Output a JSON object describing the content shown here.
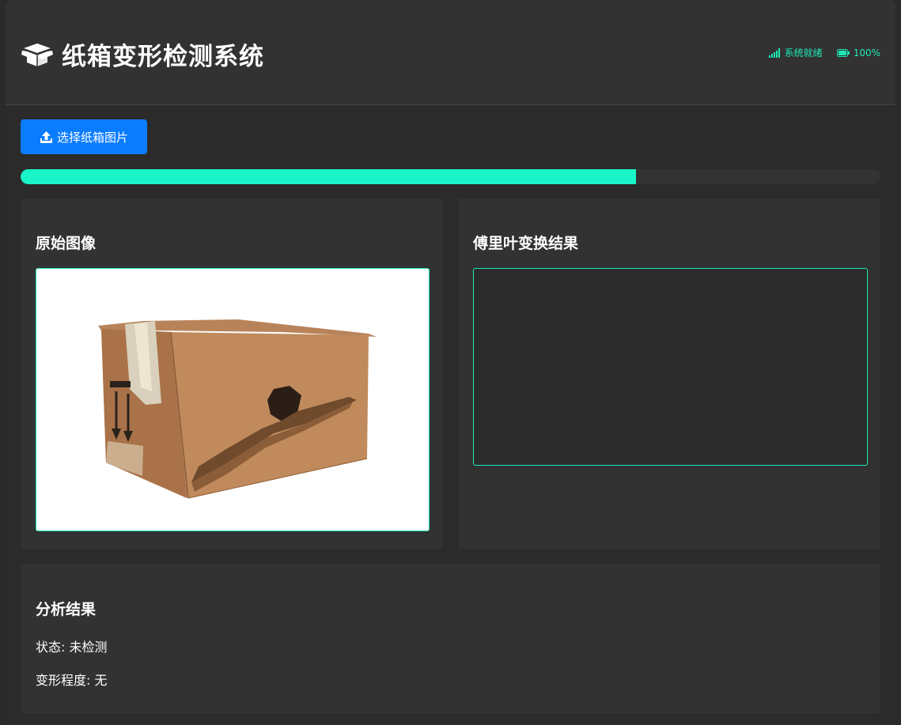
{
  "header": {
    "title": "纸箱变形检测系统",
    "title_icon": "box-open-icon",
    "status": {
      "system_label": "系统就绪",
      "system_icon": "signal-bars-icon",
      "battery_label": "100%",
      "battery_icon": "battery-icon"
    }
  },
  "toolbar": {
    "upload_label": "选择纸箱图片",
    "upload_icon": "upload-icon"
  },
  "progress": {
    "value": 0.716
  },
  "panels": {
    "original": {
      "title": "原始图像",
      "image": "damaged-cardboard-box-photo"
    },
    "fourier": {
      "title": "傅里叶变换结果"
    }
  },
  "analysis": {
    "title": "分析结果",
    "status_line": "状态: 未检测",
    "deformation_line": "变形程度: 无"
  },
  "colors": {
    "accent": "#1de9b6",
    "progress": "#19f5c8",
    "button": "#0a7cff",
    "panel": "#323232",
    "background": "#2a2a2a"
  }
}
